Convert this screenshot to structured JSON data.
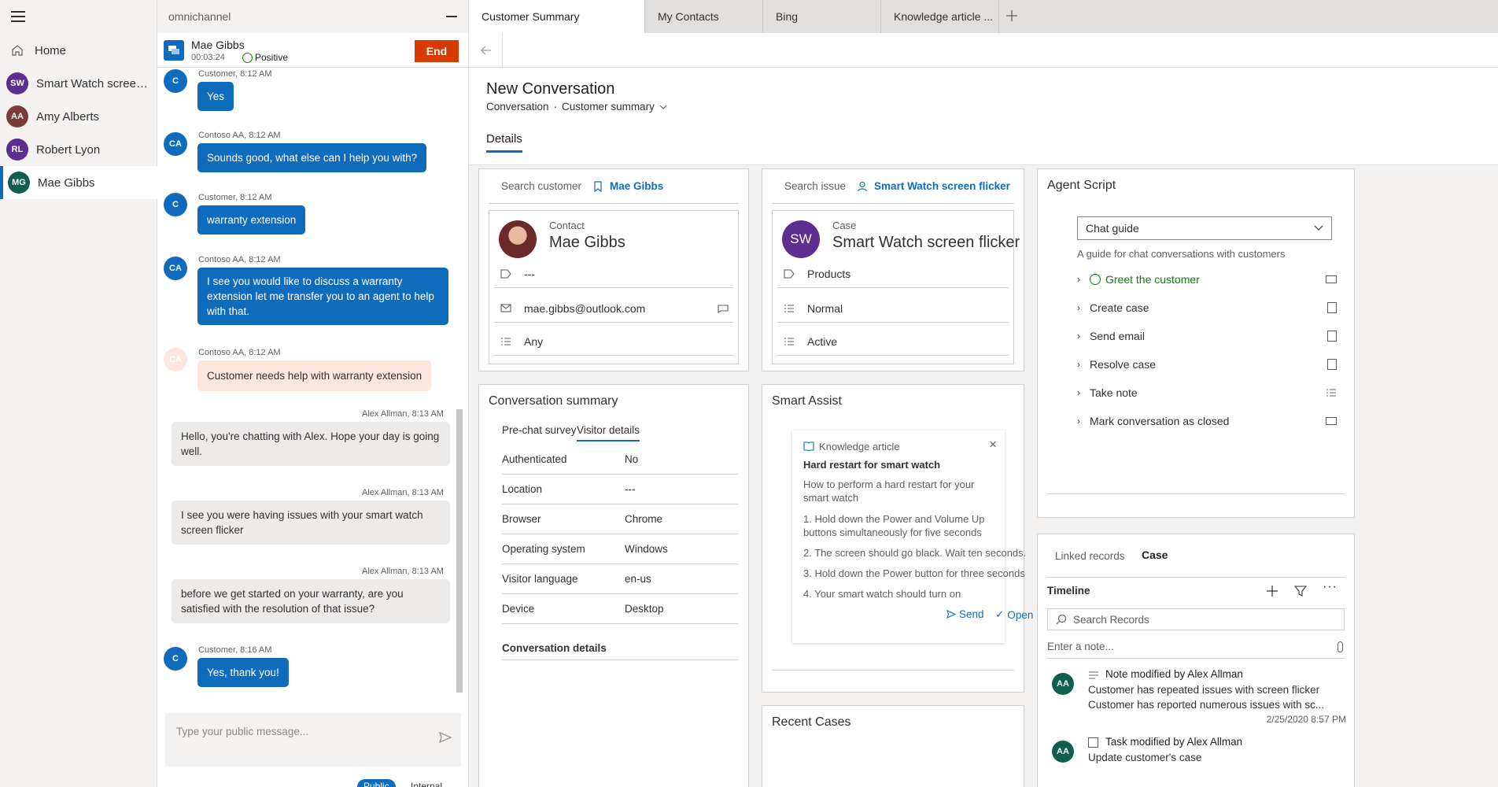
{
  "leftnav": {
    "home_label": "Home",
    "items": [
      {
        "initials": "SW",
        "label": "Smart Watch screen fli...",
        "color": "#5c2e91"
      },
      {
        "initials": "AA",
        "label": "Amy Alberts",
        "color": "#7a3b3b"
      },
      {
        "initials": "RL",
        "label": "Robert Lyon",
        "color": "#5c2e91"
      },
      {
        "initials": "MG",
        "label": "Mae Gibbs",
        "color": "#0f5f4c"
      }
    ]
  },
  "conv_panel": {
    "header": "omnichannel",
    "session": {
      "name": "Mae Gibbs",
      "time": "00:03:24",
      "sentiment": "Positive",
      "end_label": "End"
    },
    "messages": [
      {
        "avatar": "C",
        "meta": "Customer, 8:12 AM",
        "text": "Yes"
      },
      {
        "avatar": "CA",
        "meta": "Contoso AA, 8:12 AM",
        "text": "Sounds good, what else can I help you with?"
      },
      {
        "avatar": "C",
        "meta": "Customer, 8:12 AM",
        "text": "warranty extension"
      },
      {
        "avatar": "CA",
        "meta": "Contoso AA, 8:12 AM",
        "text": "I see you would like to discuss a warranty extension let me transfer you to an agent to help with that."
      },
      {
        "avatar": "CA",
        "meta": "Contoso AA, 8:12 AM",
        "text": "Customer needs help with warranty extension"
      },
      {
        "meta": "Alex Allman, 8:13 AM",
        "text": "Hello, you're chatting with Alex. Hope your day is going well."
      },
      {
        "meta": "Alex Allman, 8:13 AM",
        "text": "I see you were having issues with your smart watch screen flicker"
      },
      {
        "meta": "Alex Allman, 8:13 AM",
        "text": "before we get started on your warranty, are you satisfied with the resolution of that issue?"
      },
      {
        "avatar": "C",
        "meta": "Customer, 8:16 AM",
        "text": "Yes, thank you!"
      }
    ],
    "compose_placeholder": "Type your public message...",
    "public_label": "Public",
    "internal_label": "Internal"
  },
  "tabs": [
    "Customer Summary",
    "My Contacts",
    "Bing",
    "Knowledge article ..."
  ],
  "form": {
    "title": "New Conversation",
    "entity": "Conversation",
    "form_name": "Customer summary",
    "tab": "Details"
  },
  "customer": {
    "search_label": "Search customer",
    "selected": "Mae Gibbs",
    "type": "Contact",
    "name": "Mae Gibbs",
    "field1": "---",
    "email": "mae.gibbs@outlook.com",
    "method": "Any"
  },
  "issue": {
    "search_label": "Search issue",
    "selected": "Smart Watch screen flicker",
    "type": "Case",
    "initials": "SW",
    "title": "Smart Watch screen flicker",
    "product": "Products",
    "priority": "Normal",
    "status": "Active"
  },
  "agent_script": {
    "title": "Agent Script",
    "select_value": "Chat guide",
    "description": "A guide for chat conversations with customers",
    "steps": [
      "Greet the customer",
      "Create case",
      "Send email",
      "Resolve case",
      "Take note",
      "Mark conversation as closed"
    ]
  },
  "summary": {
    "title": "Conversation summary",
    "tabs": [
      "Pre-chat survey",
      "Visitor details"
    ],
    "rows": [
      {
        "label": "Authenticated",
        "value": "No"
      },
      {
        "label": "Location",
        "value": "---"
      },
      {
        "label": "Browser",
        "value": "Chrome"
      },
      {
        "label": "Operating system",
        "value": "Windows"
      },
      {
        "label": "Visitor language",
        "value": "en-us"
      },
      {
        "label": "Device",
        "value": "Desktop"
      }
    ],
    "details_heading": "Conversation details"
  },
  "smart_assist": {
    "title": "Smart Assist",
    "card_type": "Knowledge article",
    "card_title": "Hard restart for smart watch",
    "lines": [
      "How to perform a hard restart for your smart watch",
      "1. Hold down the Power and Volume Up buttons simultaneously for five seconds",
      "2. The screen should go black. Wait ten seconds.",
      "3. Hold down the Power button for three seconds",
      "4. Your smart watch should turn on"
    ],
    "send_label": "Send",
    "open_label": "Open"
  },
  "recent_cases": {
    "title": "Recent Cases"
  },
  "linked": {
    "tabs": [
      "Linked records",
      "Case"
    ],
    "timeline_label": "Timeline",
    "search_placeholder": "Search Records",
    "note_placeholder": "Enter a note...",
    "entries": [
      {
        "initials": "AA",
        "title": "Note modified by Alex Allman",
        "line1": "Customer has repeated issues with screen flicker",
        "line2": "Customer has reported numerous issues with sc...",
        "date": "2/25/2020 8:57 PM"
      },
      {
        "initials": "AA",
        "title": "Task modified by Alex Allman",
        "line1": "Update customer's case"
      }
    ]
  },
  "colors": {
    "accent": "#0f6cbd",
    "end": "#d83b01",
    "positive": "#107c10"
  }
}
